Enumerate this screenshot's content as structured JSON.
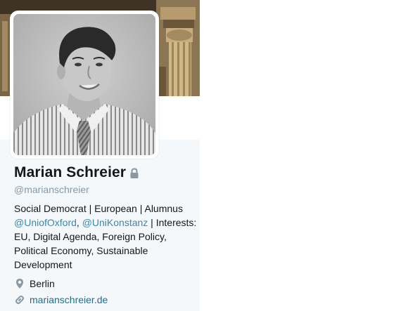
{
  "profile": {
    "display_name": "Marian Schreier",
    "screen_name": "@marianschreier",
    "protected_icon": "lock-icon",
    "bio": {
      "line_part_1": "Social Democrat | European | Alumnus ",
      "mention_1": "@UniofOxford",
      "separator": ", ",
      "mention_2": "@UniKonstanz",
      "line_part_2": " | Interests: EU, Digital Agenda, Foreign Policy, Political Economy, Sustainable Development"
    },
    "location_icon": "map-pin-icon",
    "location": "Berlin",
    "url_icon": "link-icon",
    "url": "marianschreier.de"
  },
  "colors": {
    "panel_background": "#f5f8fa",
    "name": "#14171a",
    "handle": "#8899a6",
    "link": "#1c6f8f"
  }
}
